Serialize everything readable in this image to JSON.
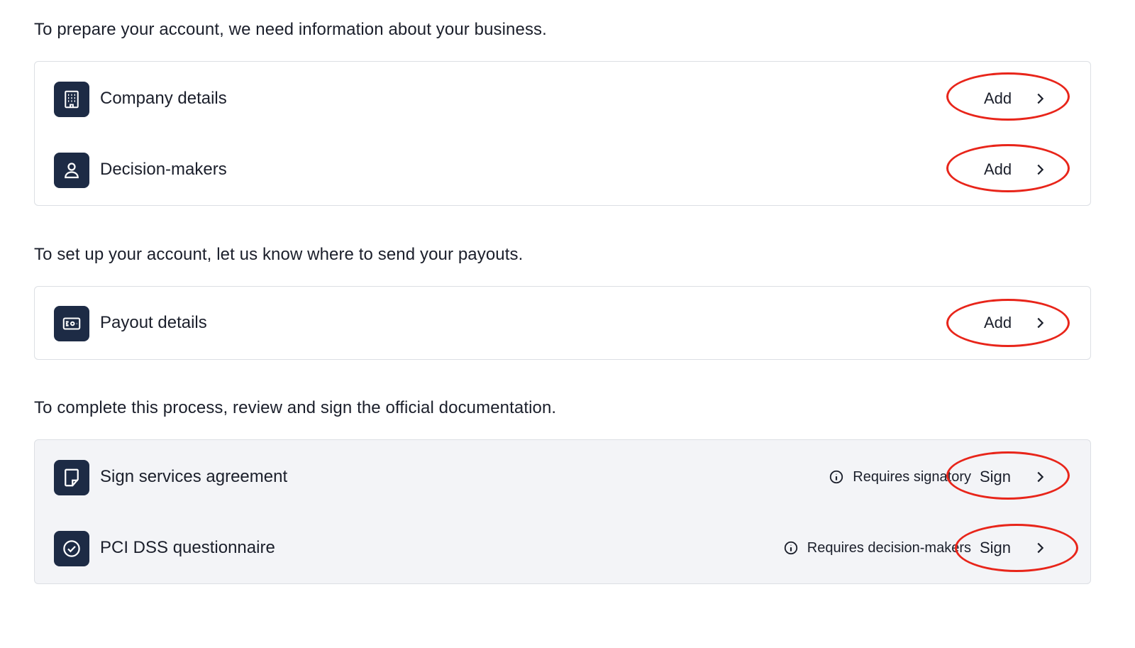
{
  "sections": [
    {
      "title": "To prepare your account, we need information about your business.",
      "items": [
        {
          "label": "Company details",
          "icon": "building-icon",
          "action": "Add"
        },
        {
          "label": "Decision-makers",
          "icon": "person-icon",
          "action": "Add"
        }
      ]
    },
    {
      "title": "To set up your account, let us know where to send your payouts.",
      "items": [
        {
          "label": "Payout details",
          "icon": "banknote-icon",
          "action": "Add"
        }
      ]
    },
    {
      "title": "To complete this process, review and sign the official documentation.",
      "items": [
        {
          "label": "Sign services agreement",
          "icon": "document-icon",
          "requirement": "Requires signatory",
          "action": "Sign"
        },
        {
          "label": "PCI DSS questionnaire",
          "icon": "check-circle-icon",
          "requirement": "Requires decision-makers",
          "action": "Sign"
        }
      ]
    }
  ],
  "colors": {
    "icon_tile": "#1d2b45",
    "annotation_ring": "#e8251a",
    "muted_card": "#f3f4f7"
  }
}
